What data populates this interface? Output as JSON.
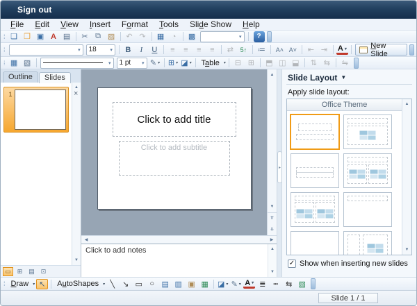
{
  "icons": {
    "up": "▲",
    "down": "▼",
    "left": "◀",
    "right": "▶",
    "prev_slide": "⇈",
    "next_slide": "⇊",
    "caret_down": "▾",
    "expand": "▸",
    "check": "✓",
    "help": "?",
    "close": "×",
    "pane_caret": "▼",
    "grip": "⁞"
  },
  "colors": {
    "accent_orange": "#F29B1D",
    "titlebar_navy": "#1F3B5F",
    "canvas_gray": "#97A5B4"
  },
  "titlebar": {
    "signout_label": "Sign out"
  },
  "menubar": {
    "items": [
      {
        "name": "menu-file",
        "label": "File",
        "accel": 0
      },
      {
        "name": "menu-edit",
        "label": "Edit",
        "accel": 0
      },
      {
        "name": "menu-view",
        "label": "View",
        "accel": 0
      },
      {
        "name": "menu-insert",
        "label": "Insert",
        "accel": 0
      },
      {
        "name": "menu-format",
        "label": "Format",
        "accel": 1
      },
      {
        "name": "menu-tools",
        "label": "Tools",
        "accel": 0
      },
      {
        "name": "menu-slide-show",
        "label": "Slide Show",
        "accel": 3
      },
      {
        "name": "menu-help",
        "label": "Help",
        "accel": 0
      }
    ]
  },
  "standard_toolbar": {
    "buttons": [
      {
        "name": "new-presentation-button",
        "glyph": "❏",
        "cls": "c-blue"
      },
      {
        "name": "open-button",
        "glyph": "❒",
        "cls": "c-yellow"
      },
      {
        "name": "save-button",
        "glyph": "▣",
        "cls": "c-blue"
      },
      {
        "name": "export-pdf-button",
        "glyph": "A",
        "cls": "c-red bold"
      },
      {
        "name": "print-button",
        "glyph": "▤",
        "cls": "c-slate"
      },
      {
        "sep": true
      },
      {
        "name": "cut-button",
        "glyph": "✂",
        "cls": "c-slate"
      },
      {
        "name": "copy-button",
        "glyph": "⧉",
        "cls": "c-slate"
      },
      {
        "name": "paste-button",
        "glyph": "▨",
        "cls": "c-tan"
      },
      {
        "sep": true
      },
      {
        "name": "undo-button",
        "glyph": "↶",
        "disabled": true
      },
      {
        "name": "redo-button",
        "glyph": "↷",
        "disabled": true
      },
      {
        "sep": true
      },
      {
        "name": "insert-table-button",
        "glyph": "▦",
        "cls": "c-blue"
      },
      {
        "name": "insert-chart-button",
        "glyph": "◔",
        "disabled": true
      },
      {
        "sep": true
      },
      {
        "name": "show-grid-button",
        "glyph": "▩",
        "cls": "c-blue"
      }
    ],
    "zoom_value": ""
  },
  "formatting_toolbar": {
    "font_name": "",
    "font_size": "18",
    "buttons": [
      {
        "name": "bold-button",
        "glyph": "B",
        "cls": "bold"
      },
      {
        "name": "italic-button",
        "glyph": "I",
        "cls": "ital"
      },
      {
        "name": "underline-button",
        "glyph": "U",
        "cls": "und"
      },
      {
        "sep": true
      },
      {
        "name": "align-left-button",
        "glyph": "≡",
        "disabled": true
      },
      {
        "name": "align-center-button",
        "glyph": "≡",
        "disabled": true
      },
      {
        "name": "align-right-button",
        "glyph": "≡",
        "disabled": true
      },
      {
        "name": "align-justify-button",
        "glyph": "≡",
        "disabled": true
      },
      {
        "sep": true
      },
      {
        "name": "character-spacing-button",
        "glyph": "⇄",
        "disabled": true
      },
      {
        "name": "renumber-slides-button",
        "glyph": "5↑",
        "cls": "c-green small"
      },
      {
        "sep": true
      },
      {
        "name": "bullets-button",
        "glyph": "≔",
        "cls": "c-slate"
      },
      {
        "sep": true
      },
      {
        "name": "increase-font-size-button",
        "glyph": "A˄",
        "cls": "c-slate small"
      },
      {
        "name": "decrease-font-size-button",
        "glyph": "A˅",
        "cls": "c-slate small"
      },
      {
        "sep": true
      },
      {
        "name": "decrease-indent-button",
        "glyph": "⇤",
        "disabled": true
      },
      {
        "name": "increase-indent-button",
        "glyph": "⇥",
        "disabled": true
      },
      {
        "sep": true
      },
      {
        "name": "font-color-button",
        "glyph": "A",
        "cls": "fontcolor bold",
        "caret": true
      }
    ],
    "new_slide_label": "New Slide",
    "new_slide_accel": 0
  },
  "tables_toolbar": {
    "lead": [
      {
        "name": "draw-table-button",
        "glyph": "▦",
        "cls": "c-blue"
      },
      {
        "name": "erase-table-button",
        "glyph": "▧",
        "cls": "c-slate"
      },
      {
        "sep": true
      }
    ],
    "line_weight": "1 pt",
    "mid": [
      {
        "name": "line-color-button",
        "glyph": "✎",
        "cls": "c-slate",
        "caret": true
      },
      {
        "sep": true
      },
      {
        "name": "borders-button",
        "glyph": "⊞",
        "cls": "c-blue",
        "caret": true
      },
      {
        "name": "fill-color-button",
        "glyph": "◪",
        "cls": "c-blue",
        "caret": true
      },
      {
        "sep": true
      }
    ],
    "table_label": "Table",
    "table_accel": 1,
    "tail": [
      {
        "sep": true
      },
      {
        "name": "merge-cells-button",
        "glyph": "⊟",
        "disabled": true
      },
      {
        "name": "split-cell-button",
        "glyph": "⊞",
        "disabled": true
      },
      {
        "sep": true
      },
      {
        "name": "align-top-button",
        "glyph": "⬒",
        "disabled": true
      },
      {
        "name": "center-vertically-button",
        "glyph": "◫",
        "disabled": true
      },
      {
        "name": "align-bottom-button",
        "glyph": "⬓",
        "disabled": true
      },
      {
        "sep": true
      },
      {
        "name": "distribute-rows-button",
        "glyph": "⇅",
        "disabled": true
      },
      {
        "name": "distribute-columns-button",
        "glyph": "⇆",
        "disabled": true
      },
      {
        "sep": true
      },
      {
        "name": "autofit-button",
        "glyph": "⇋",
        "disabled": true
      }
    ]
  },
  "left_panel": {
    "tabs": [
      {
        "name": "tab-outline",
        "label": "Outline"
      },
      {
        "name": "tab-slides",
        "label": "Slides",
        "cls": "active"
      }
    ],
    "slide_number": "1",
    "view_buttons": [
      {
        "name": "normal-view-button",
        "glyph": "▭",
        "cls": "sel"
      },
      {
        "name": "slide-sorter-view-button",
        "glyph": "⊞"
      },
      {
        "name": "reading-view-button",
        "glyph": "▤"
      },
      {
        "name": "slideshow-button",
        "glyph": "⊡"
      }
    ]
  },
  "editor": {
    "title_placeholder": "Click to add title",
    "subtitle_placeholder": "Click to add subtitle"
  },
  "notes": {
    "placeholder": "Click to add notes"
  },
  "task_pane": {
    "title": "Slide Layout",
    "apply_label": "Apply slide layout:",
    "theme_header": "Office Theme",
    "layouts": [
      "title-slide",
      "title-and-content",
      "section-header",
      "two-content",
      "comparison",
      "title-only",
      "blank",
      "content-with-caption"
    ],
    "selected_layout": "title-slide",
    "checkbox_label": "Show when inserting new slides",
    "checkbox_checked": true
  },
  "draw_toolbar": {
    "draw_label": "Draw",
    "draw_accel": 0,
    "select_button": {
      "glyph": "↖"
    },
    "autoshapes_label": "AutoShapes",
    "autoshapes_accel": 1,
    "shapes": [
      {
        "name": "line-button",
        "glyph": "╲",
        "cls": "c-dark"
      },
      {
        "name": "arrow-button",
        "glyph": "↘",
        "cls": "c-dark"
      },
      {
        "name": "rectangle-button",
        "glyph": "▭",
        "cls": "c-dark"
      },
      {
        "name": "oval-button",
        "glyph": "○",
        "cls": "c-dark"
      },
      {
        "name": "text-box-button",
        "glyph": "▤",
        "cls": "c-blue"
      },
      {
        "name": "insert-diagram-button",
        "glyph": "▥",
        "cls": "c-blue"
      },
      {
        "name": "insert-clipart-button",
        "glyph": "▣",
        "cls": "c-tan"
      },
      {
        "name": "insert-picture-button",
        "glyph": "▦",
        "cls": "c-green"
      },
      {
        "sep": true
      }
    ],
    "colors": [
      {
        "name": "fill-color-button",
        "glyph": "◪",
        "cls": "c-blue",
        "caret": true
      },
      {
        "name": "line-color-button",
        "glyph": "✎",
        "cls": "c-slate",
        "caret": true
      },
      {
        "name": "font-color-button",
        "glyph": "A",
        "cls": "fontcolor bold",
        "caret": true
      }
    ],
    "styles": [
      {
        "name": "line-style-button",
        "glyph": "≣",
        "cls": "c-dark"
      },
      {
        "name": "dash-style-button",
        "glyph": "┅",
        "cls": "c-dark"
      },
      {
        "name": "arrow-style-button",
        "glyph": "⇆",
        "cls": "c-dark"
      },
      {
        "name": "shadow-3d-button",
        "glyph": "▧",
        "cls": "c-green"
      }
    ]
  },
  "status_bar": {
    "slide_indicator": "Slide 1 / 1"
  }
}
